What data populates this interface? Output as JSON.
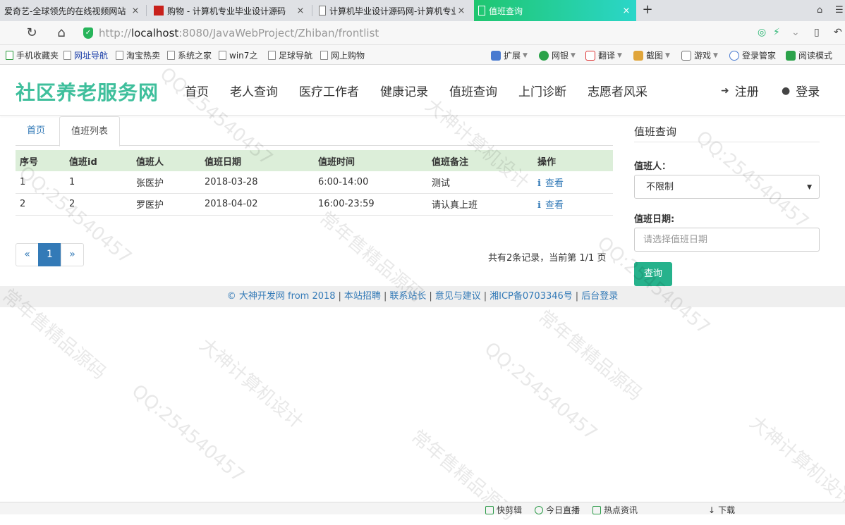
{
  "browser": {
    "tabs": [
      {
        "title": "爱奇艺-全球领先的在线视频网站",
        "active": false
      },
      {
        "title": "购物 - 计算机专业毕业设计源码",
        "active": false
      },
      {
        "title": "计算机毕业设计源码网-计算机专业",
        "active": false
      },
      {
        "title": "值班查询",
        "active": true
      }
    ],
    "new_tab": "+",
    "close": "×",
    "url_prefix": "http://",
    "url_host": "localhost",
    "url_path": ":8080/JavaWebProject/Zhiban/frontlist",
    "bookmarks_left": [
      "手机收藏夹",
      "网址导航",
      "淘宝热卖",
      "系统之家",
      "win7之",
      "足球导航",
      "网上购物"
    ],
    "bookmarks_right": [
      "扩展",
      "网银",
      "翻译",
      "截图",
      "游戏",
      "登录管家",
      "阅读模式"
    ]
  },
  "site": {
    "logo": "社区养老服务网",
    "nav": [
      "首页",
      "老人查询",
      "医疗工作者",
      "健康记录",
      "值班查询",
      "上门诊断",
      "志愿者风采"
    ],
    "register": "注册",
    "login": "登录"
  },
  "content": {
    "tabs": [
      "首页",
      "值班列表"
    ],
    "table": {
      "headers": [
        "序号",
        "值班id",
        "值班人",
        "值班日期",
        "值班时间",
        "值班备注",
        "操作"
      ],
      "rows": [
        [
          "1",
          "1",
          "张医护",
          "2018-03-28",
          "6:00-14:00",
          "测试",
          "查看"
        ],
        [
          "2",
          "2",
          "罗医护",
          "2018-04-02",
          "16:00-23:59",
          "请认真上班",
          "查看"
        ]
      ]
    },
    "pager": {
      "prev": "«",
      "current": "1",
      "next": "»"
    },
    "record_info": "共有2条记录，当前第 1/1 页"
  },
  "sidebar": {
    "title": "值班查询",
    "person_label": "值班人：",
    "person_value": "不限制",
    "date_label": "值班日期:",
    "date_placeholder": "请选择值班日期",
    "query_button": "查询"
  },
  "footer": {
    "links": [
      "© 大神开发网 from 2018",
      "本站招聘",
      "联系站长",
      "意见与建议",
      "湘ICP备0703346号",
      "后台登录"
    ]
  },
  "statusbar": [
    "快剪辑",
    "今日直播",
    "热点资讯",
    "下载"
  ],
  "watermark": [
    "大神计算机设计",
    "QQ:254540457",
    "常年售精品源码"
  ],
  "colors": {
    "accent": "#3fbf9c",
    "button": "#26b28c",
    "link": "#337ab7",
    "table_header": "#dceed9",
    "active_tab": "#1fc66f"
  }
}
